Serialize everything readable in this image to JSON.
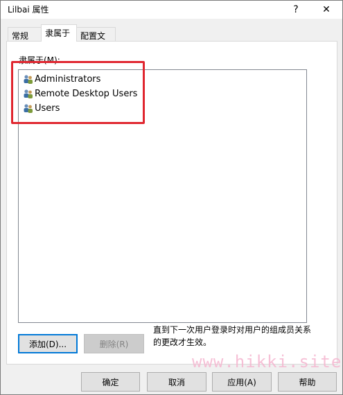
{
  "window": {
    "title": "Lilbai 属性",
    "help_glyph": "?",
    "close_glyph": "✕"
  },
  "tabs": [
    {
      "label": "常规"
    },
    {
      "label": "隶属于"
    },
    {
      "label": "配置文件"
    }
  ],
  "memberof": {
    "label": "隶属于(M):",
    "groups": [
      {
        "name": "Administrators",
        "icon": "group-icon"
      },
      {
        "name": "Remote Desktop Users",
        "icon": "group-icon"
      },
      {
        "name": "Users",
        "icon": "group-icon"
      }
    ],
    "note": "直到下一次用户登录时对用户的组成员关系的更改才生效。",
    "add_label": "添加(D)...",
    "remove_label": "删除(R)"
  },
  "footer": {
    "ok_label": "确定",
    "cancel_label": "取消",
    "apply_label": "应用(A)",
    "help_label": "帮助"
  },
  "watermark": "www.hikki.site",
  "colors": {
    "annotation": "#e0262f",
    "focus": "#0078d7",
    "watermark": "#f5b6d0"
  }
}
